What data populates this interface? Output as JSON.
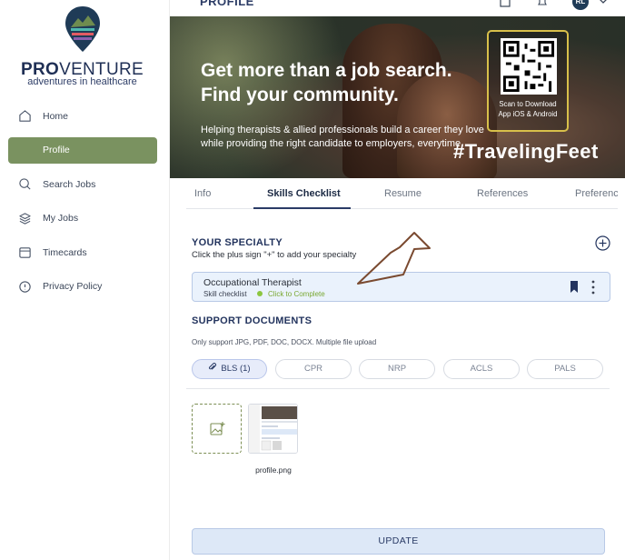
{
  "brand": {
    "name_part1": "PRO",
    "name_part2": "VENTURE",
    "tagline": "adventures in healthcare"
  },
  "sidebar": {
    "items": [
      {
        "label": "Home",
        "icon": "home-icon",
        "active": false
      },
      {
        "label": "Profile",
        "icon": "user-icon",
        "active": true
      },
      {
        "label": "Search Jobs",
        "icon": "search-icon",
        "active": false
      },
      {
        "label": "My Jobs",
        "icon": "layers-icon",
        "active": false
      },
      {
        "label": "Timecards",
        "icon": "calendar-icon",
        "active": false
      },
      {
        "label": "Privacy Policy",
        "icon": "shield-icon",
        "active": false
      }
    ]
  },
  "header": {
    "title": "PROFILE",
    "avatar_initials": "RL"
  },
  "banner": {
    "headline_line1": "Get more than a job search.",
    "headline_line2": "Find your community.",
    "subtext": "Helping therapists & allied professionals build a career they love while providing the right candidate to employers, everytime.",
    "hashtag": "#TravelingFeet",
    "qr_caption_line1": "Scan to Download",
    "qr_caption_line2": "App iOS & Android"
  },
  "tabs": [
    {
      "label": "Info",
      "active": false
    },
    {
      "label": "Skills Checklist",
      "active": true
    },
    {
      "label": "Resume",
      "active": false
    },
    {
      "label": "References",
      "active": false
    },
    {
      "label": "Preferences",
      "active": false
    }
  ],
  "specialty": {
    "title": "YOUR SPECIALTY",
    "hint": "Click the plus sign \"+\" to add your specialty",
    "card": {
      "name": "Occupational Therapist",
      "sub_label": "Skill checklist",
      "status_link": "Click to Complete",
      "status_color": "#8cc63f"
    }
  },
  "documents": {
    "title": "SUPPORT DOCUMENTS",
    "hint": "Only support JPG, PDF, DOC, DOCX. Multiple file upload",
    "chips": [
      {
        "label": "BLS (1)",
        "active": true
      },
      {
        "label": "CPR",
        "active": false
      },
      {
        "label": "NRP",
        "active": false
      },
      {
        "label": "ACLS",
        "active": false
      },
      {
        "label": "PALS",
        "active": false
      }
    ],
    "file_name": "profile.png"
  },
  "actions": {
    "update_label": "UPDATE"
  },
  "colors": {
    "accent_green": "#7a9260",
    "navy": "#23345e",
    "qr_border": "#d8c04a"
  }
}
